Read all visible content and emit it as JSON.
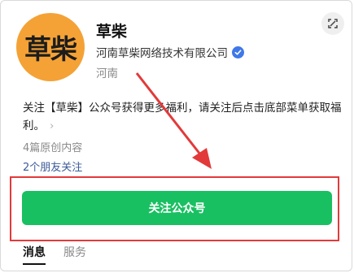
{
  "profile": {
    "avatar_text": "草柴",
    "name": "草柴",
    "company": "河南草柴网络技术有限公司",
    "region": "河南",
    "avatar_color": "#f4a236"
  },
  "description": "关注【草柴】公众号获得更多福利，请关注后点击底部菜单获取福利。",
  "original_count": "4篇原创内容",
  "friends_following": "2个朋友关注",
  "follow_button": "关注公众号",
  "tabs": [
    "消息",
    "服务"
  ],
  "icons": {
    "verified": "verified-check-icon",
    "expand": "expand-icon",
    "chevron": "chevron-right-icon"
  },
  "colors": {
    "accent_green": "#19c062",
    "highlight_red": "#e23a3a",
    "link_blue": "#3c5a99",
    "verified_blue": "#3f78e8"
  }
}
